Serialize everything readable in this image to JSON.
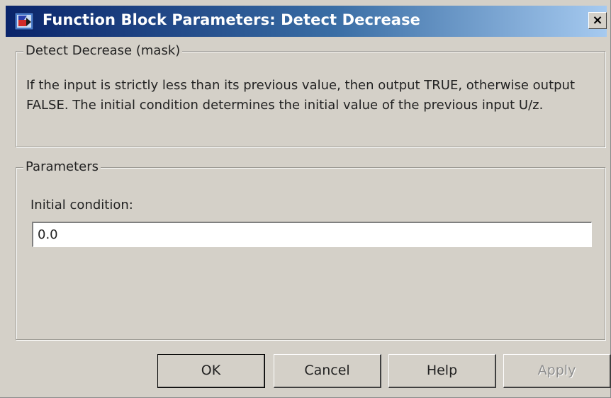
{
  "window": {
    "title": "Function Block Parameters: Detect Decrease",
    "close_label": "×"
  },
  "description_group": {
    "legend": "Detect Decrease (mask)",
    "text": "If the input is strictly less than its previous value, then output TRUE, otherwise output FALSE.  The initial condition determines the initial value of the previous input U/z."
  },
  "parameters_group": {
    "legend": "Parameters",
    "initial_condition_label": "Initial condition:",
    "initial_condition_value": "0.0"
  },
  "buttons": {
    "ok": "OK",
    "cancel": "Cancel",
    "help": "Help",
    "apply": "Apply"
  },
  "colors": {
    "title_gradient_start": "#0a246a",
    "title_gradient_end": "#a6caf0",
    "dialog_background": "#d4d0c8",
    "disabled_text": "#8d8d8d"
  },
  "icons": {
    "app": "simulink-block-icon",
    "close": "close-icon"
  }
}
